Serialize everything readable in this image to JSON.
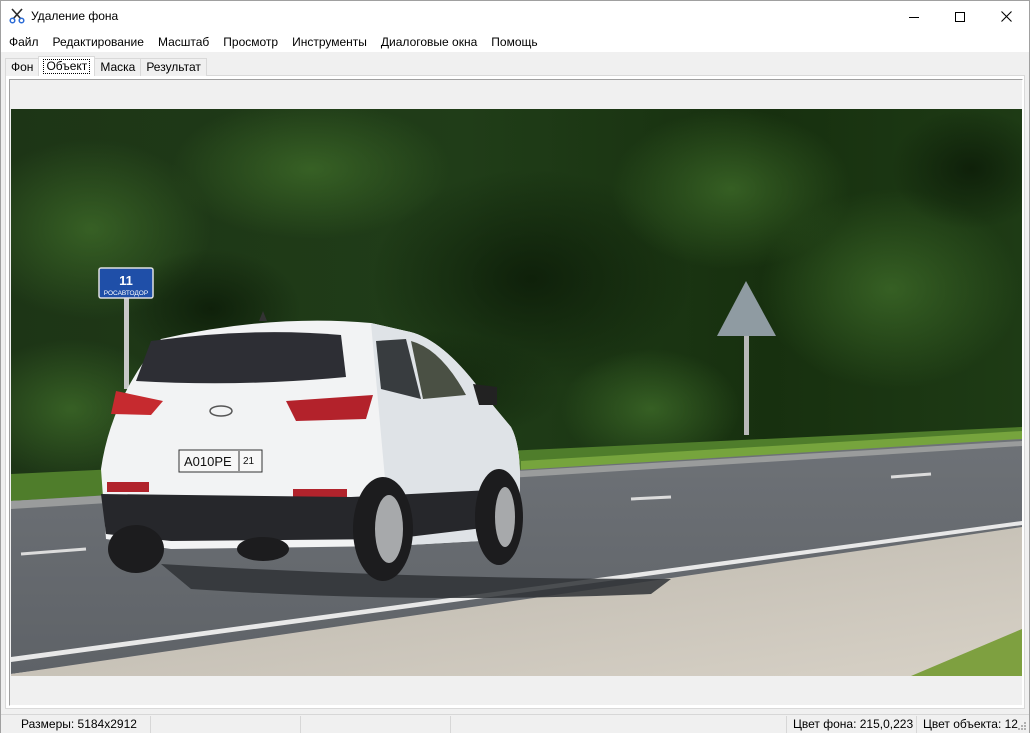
{
  "window": {
    "title": "Удаление фона",
    "icon": "scissors-icon"
  },
  "menu": [
    {
      "label": "Файл"
    },
    {
      "label": "Редактирование"
    },
    {
      "label": "Масштаб"
    },
    {
      "label": "Просмотр"
    },
    {
      "label": "Инструменты"
    },
    {
      "label": "Диалоговые окна"
    },
    {
      "label": "Помощь"
    }
  ],
  "tabs": [
    {
      "label": "Фон",
      "active": false
    },
    {
      "label": "Объект",
      "active": true
    },
    {
      "label": "Маска",
      "active": false
    },
    {
      "label": "Результат",
      "active": false
    }
  ],
  "photo": {
    "sign_number": "11",
    "sign_org": "РОСАВТОДОР",
    "plate_main": "А010РЕ",
    "plate_region": "21"
  },
  "status": {
    "dimensions": "Размеры: 5184x2912",
    "bg_color": "Цвет фона: 215,0,223",
    "obj_color": "Цвет объекта: 12"
  }
}
